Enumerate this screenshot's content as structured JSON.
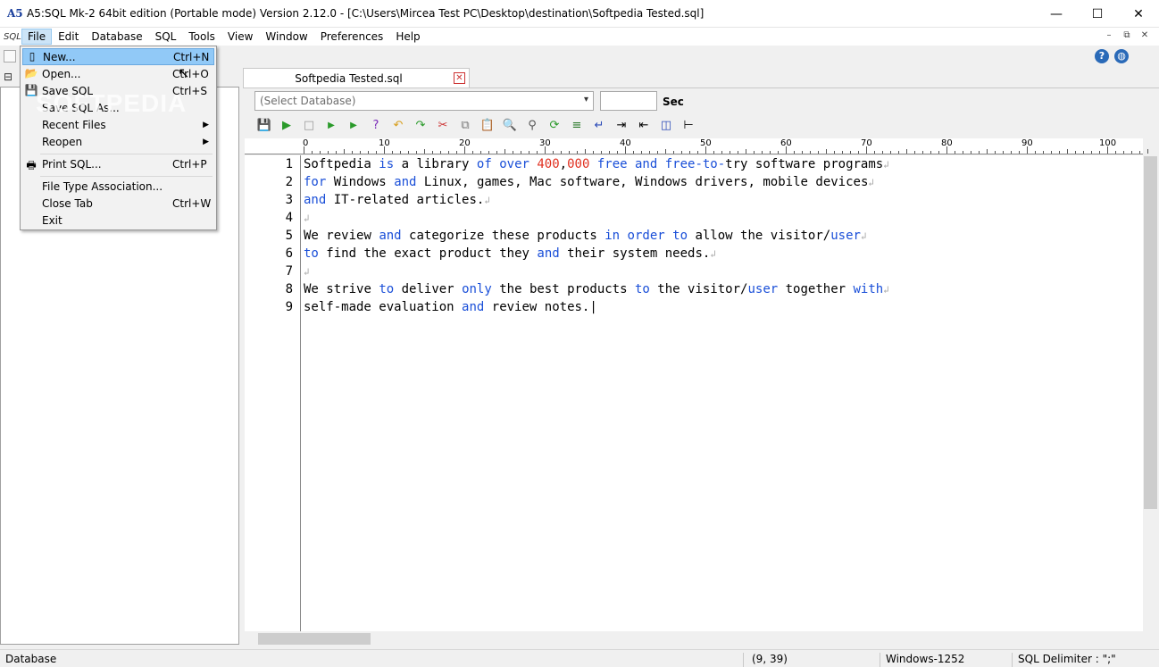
{
  "window": {
    "title": "A5:SQL Mk-2 64bit edition (Portable mode) Version 2.12.0 - [C:\\Users\\Mircea Test PC\\Desktop\\destination\\Softpedia Tested.sql]",
    "app_icon": "A5",
    "minimize": "—",
    "maximize": "☐",
    "close": "✕"
  },
  "menubar": {
    "sql_icon": "SQL",
    "items": [
      "File",
      "Edit",
      "Database",
      "SQL",
      "Tools",
      "View",
      "Window",
      "Preferences",
      "Help"
    ],
    "mdi_min": "–",
    "mdi_restore": "⧉",
    "mdi_close": "✕"
  },
  "file_menu": {
    "items": [
      {
        "label": "New...",
        "shortcut": "Ctrl+N",
        "icon": "new-file-icon"
      },
      {
        "label": "Open...",
        "shortcut": "Ctrl+O",
        "icon": "open-folder-icon"
      },
      {
        "label": "Save SQL",
        "shortcut": "Ctrl+S",
        "icon": "save-icon"
      },
      {
        "label": "Save SQL As...",
        "shortcut": "",
        "icon": ""
      },
      {
        "label": "Recent Files",
        "shortcut": "",
        "submenu": true
      },
      {
        "label": "Reopen",
        "shortcut": "",
        "submenu": true
      },
      {
        "label": "Print SQL...",
        "shortcut": "Ctrl+P",
        "icon": "printer-icon"
      },
      {
        "label": "File Type Association...",
        "shortcut": ""
      },
      {
        "label": "Close Tab",
        "shortcut": "Ctrl+W"
      },
      {
        "label": "Exit",
        "shortcut": ""
      }
    ]
  },
  "watermark": "SOFTPEDIA",
  "tab": {
    "title": "Softpedia Tested.sql",
    "close": "✕"
  },
  "query_bar": {
    "database_placeholder": "(Select Database)",
    "sec_label": "Sec"
  },
  "ruler": {
    "labels": [
      "0",
      "10",
      "20",
      "30",
      "40",
      "50",
      "60",
      "70",
      "80",
      "90",
      "100"
    ]
  },
  "editor": {
    "line_numbers": [
      "1",
      "2",
      "3",
      "4",
      "5",
      "6",
      "7",
      "8",
      "9"
    ],
    "lines": [
      "Softpedia is a library of over 400,000 free and free-to-try software programs",
      "for Windows and Linux, games, Mac software, Windows drivers, mobile devices",
      "and IT-related articles.",
      "",
      "We review and categorize these products in order to allow the visitor/user",
      "to find the exact product they and their system needs.",
      "",
      "We strive to deliver only the best products to the visitor/user together with",
      "self-made evaluation and review notes."
    ]
  },
  "statusbar": {
    "left": "Database",
    "position": "(9, 39)",
    "encoding": "Windows-1252",
    "delimiter": "SQL Delimiter : \";\""
  }
}
